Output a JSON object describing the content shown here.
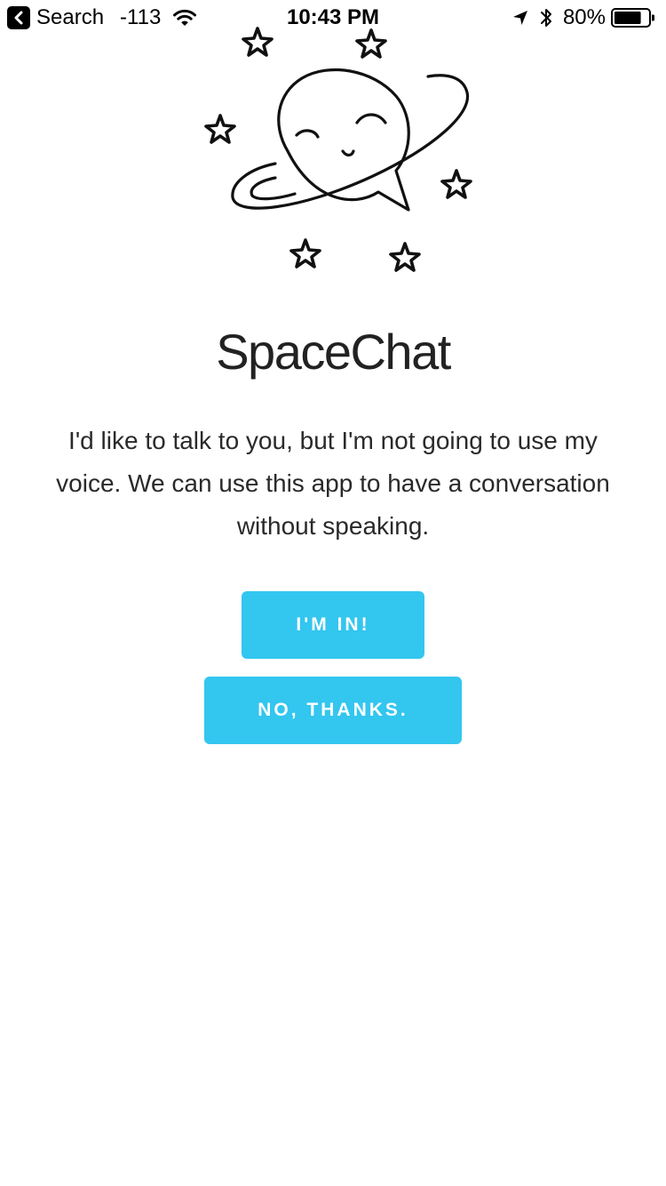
{
  "status_bar": {
    "back_label": "Search",
    "signal": "-113",
    "time": "10:43 PM",
    "battery_percent": "80%",
    "battery_level": 0.8,
    "icons": [
      "back-chevron-icon",
      "wifi-icon",
      "location-arrow-icon",
      "bluetooth-icon",
      "battery-icon"
    ]
  },
  "app": {
    "title": "SpaceChat",
    "intro": "I'd like to talk to you, but I'm not going to use my voice. We can use this app to have a conversation without speaking.",
    "illustration": "planet-chat-bubble-with-stars"
  },
  "actions": {
    "accept_label": "I'M IN!",
    "decline_label": "NO, THANKS."
  },
  "colors": {
    "accent": "#33c6ef",
    "text": "#222222",
    "background": "#ffffff"
  }
}
